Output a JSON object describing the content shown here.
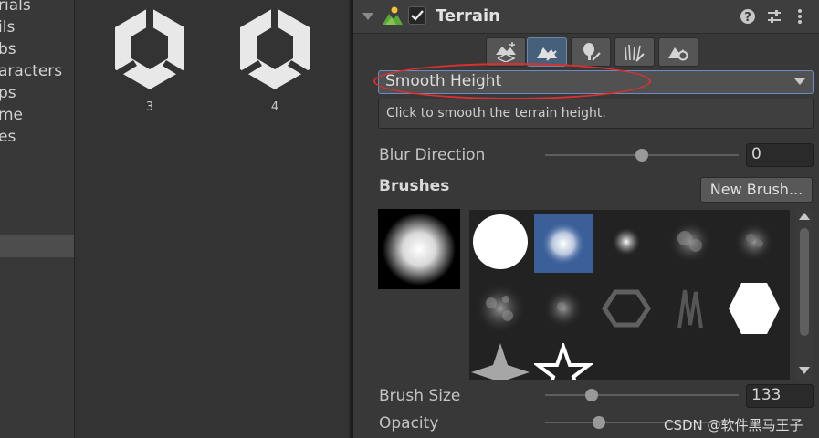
{
  "hierarchy": {
    "items": [
      "rials",
      "ils",
      "bs",
      "aracters",
      "ps",
      "me",
      "es"
    ]
  },
  "assets": [
    {
      "label": "3"
    },
    {
      "label": "4"
    }
  ],
  "inspector": {
    "component_title": "Terrain",
    "enabled": true,
    "tools": [
      {
        "icon": "raise-terrain-icon",
        "active": false
      },
      {
        "icon": "paint-terrain-icon",
        "active": true
      },
      {
        "icon": "paint-trees-icon",
        "active": false
      },
      {
        "icon": "paint-details-icon",
        "active": false
      },
      {
        "icon": "terrain-settings-icon",
        "active": false
      }
    ],
    "mode_dropdown": {
      "selected": "Smooth Height"
    },
    "help_text": "Click to smooth the terrain height.",
    "blur_direction": {
      "label": "Blur Direction",
      "value": "0",
      "slider_fraction": 0.5
    },
    "brushes": {
      "title": "Brushes",
      "new_button": "New Brush...",
      "selected_index": 1
    },
    "brush_size": {
      "label": "Brush Size",
      "value": "133",
      "slider_fraction": 0.24
    },
    "opacity": {
      "label": "Opacity",
      "slider_fraction": 0.28
    }
  },
  "watermark": "CSDN @软件黑马王子",
  "colors": {
    "accent": "#3a5f99",
    "highlight_circle": "#d93030"
  }
}
